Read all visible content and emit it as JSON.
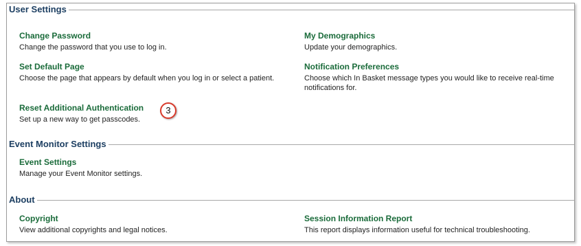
{
  "user_settings": {
    "title": "User Settings",
    "items": [
      {
        "label": "Change Password",
        "desc": "Change the password that you use to log in."
      },
      {
        "label": "My Demographics",
        "desc": "Update your demographics."
      },
      {
        "label": "Set Default Page",
        "desc": "Choose the page that appears by default when you log in or select a patient."
      },
      {
        "label": "Notification Preferences",
        "desc": "Choose which In Basket message types you would like to receive real-time notifications for."
      },
      {
        "label": "Reset Additional Authentication",
        "desc": "Set up a new way to get passcodes."
      }
    ],
    "callout_number": "3"
  },
  "event_monitor_settings": {
    "title": "Event Monitor Settings",
    "items": [
      {
        "label": "Event Settings",
        "desc": "Manage your Event Monitor settings."
      }
    ]
  },
  "about": {
    "title": "About",
    "items": [
      {
        "label": "Copyright",
        "desc": "View additional copyrights and legal notices."
      },
      {
        "label": "Session Information Report",
        "desc": "This report displays information useful for technical troubleshooting."
      }
    ]
  },
  "colors": {
    "section_title": "#1d3f62",
    "link": "#1a6b3a",
    "callout_ring": "#d93a2b"
  }
}
